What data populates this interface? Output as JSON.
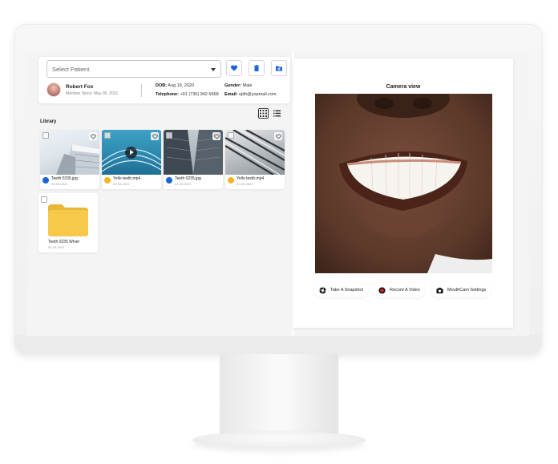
{
  "patient": {
    "select_placeholder": "Select Patient",
    "name": "Robert Fox",
    "member_since": "Member Since: May 05, 2021",
    "dob_label": "DOB:",
    "dob_value": "Aug 19, 2020",
    "telephone_label": "Telephone:",
    "telephone_value": "+91 (730) 942 6668",
    "gender_label": "Gender:",
    "gender_value": "Male",
    "email_label": "Email:",
    "email_value": "ojith@yopmail.com"
  },
  "actions": {
    "favorite_icon": "heart-icon",
    "delete_icon": "trash-icon",
    "add_folder_icon": "folder-plus-icon"
  },
  "library": {
    "title": "Library",
    "items": [
      {
        "name": "Teeth 0235.jpg",
        "date": "02-03-2021",
        "type": "image"
      },
      {
        "name": "Yello teeth.mp4",
        "date": "02-03-2021",
        "type": "video"
      },
      {
        "name": "Teeth 0235.jpg",
        "date": "02-03-2021",
        "type": "image"
      },
      {
        "name": "Yello teeth.mp4",
        "date": "02-03-2021",
        "type": "video"
      }
    ],
    "folder": {
      "name": "Teeth 0235 Winer",
      "date": "02-03-2021"
    }
  },
  "camera": {
    "title": "Camera view",
    "buttons": {
      "snapshot": "Take A Snapshot",
      "record": "Record A Video",
      "settings": "MouthCam Settings"
    }
  },
  "colors": {
    "accent": "#1e63d6",
    "folder": "#f6c94a",
    "record": "#d0232a"
  }
}
